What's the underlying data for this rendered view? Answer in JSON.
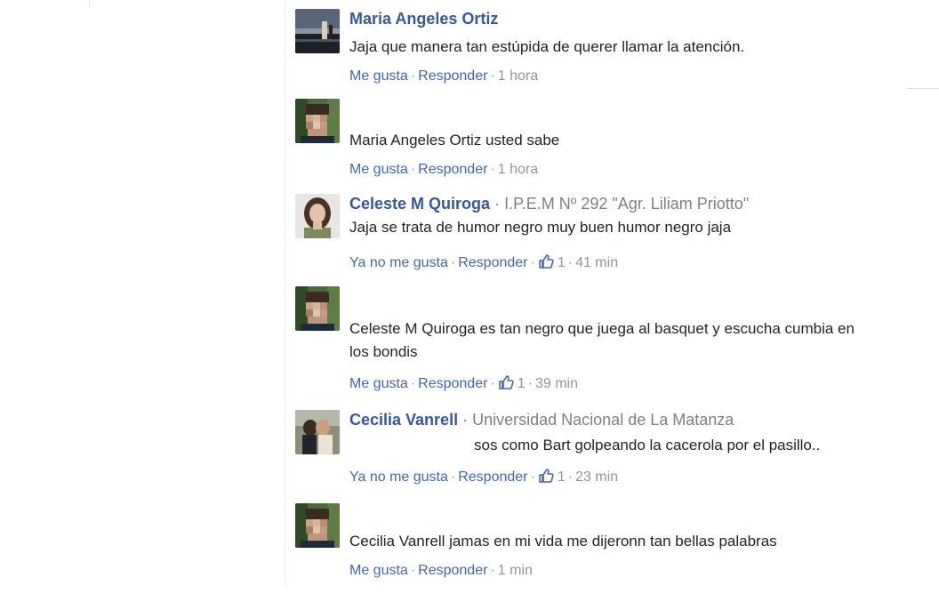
{
  "comments": [
    {
      "author": "Maria Angeles Ortiz",
      "affiliation": "",
      "text": "Jaja que manera tan estúpida de querer llamar la atención.",
      "like_label": "Me gusta",
      "reply_label": "Responder",
      "likes": "",
      "time": "1 hora",
      "avatar": "night-landscape-avatar"
    },
    {
      "author": "",
      "affiliation": "",
      "text": "Maria Angeles Ortiz usted sabe",
      "like_label": "Me gusta",
      "reply_label": "Responder",
      "likes": "",
      "time": "1 hora",
      "avatar": "pixelated-face-avatar"
    },
    {
      "author": "Celeste M Quiroga",
      "affiliation": "I.P.E.M Nº 292 \"Agr. Liliam Priotto\"",
      "text": "Jaja se trata de humor negro muy buen humor negro jaja",
      "like_label": "Ya no me gusta",
      "reply_label": "Responder",
      "likes": "1",
      "time": "41 min",
      "avatar": "woman-portrait-avatar"
    },
    {
      "author": "",
      "affiliation": "",
      "text": "Celeste M Quiroga es tan negro que juega al basquet y escucha cumbia en los bondis",
      "like_label": "Me gusta",
      "reply_label": "Responder",
      "likes": "1",
      "time": "39 min",
      "avatar": "pixelated-face-avatar"
    },
    {
      "author": "Cecilia Vanrell",
      "affiliation": "Universidad Nacional de La Matanza",
      "text": "sos como Bart golpeando la cacerola por el pasillo..",
      "like_label": "Ya no me gusta",
      "reply_label": "Responder",
      "likes": "1",
      "time": "23 min",
      "avatar": "couple-photo-avatar"
    },
    {
      "author": "",
      "affiliation": "",
      "text": "Cecilia Vanrell jamas en mi vida me dijeronn tan bellas palabras",
      "like_label": "Me gusta",
      "reply_label": "Responder",
      "likes": "",
      "time": "1 min",
      "avatar": "pixelated-face-avatar"
    }
  ],
  "separator": "·",
  "colors": {
    "author": "#365899",
    "link": "#4267b2",
    "meta": "#90949c",
    "text": "#1d2129",
    "affiliation": "#7f7f7f"
  }
}
